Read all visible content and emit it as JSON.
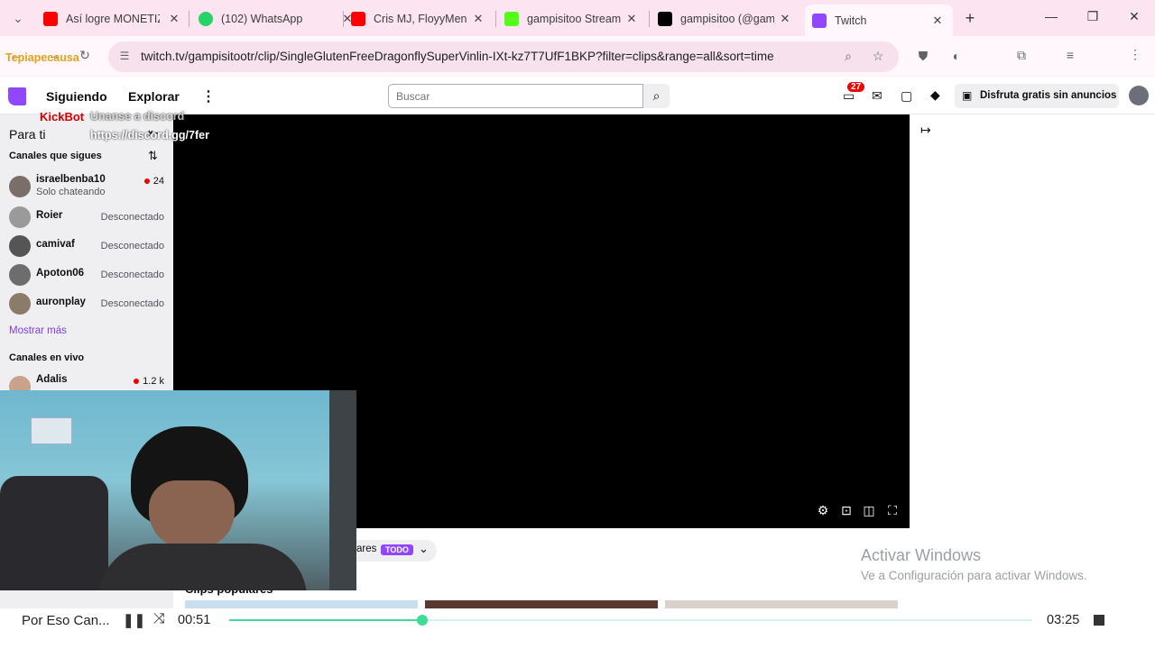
{
  "browser": {
    "tabs": [
      {
        "title": "Así logre MONETIZ",
        "favicon_color": "#ff0000",
        "favicon_icon": "youtube-icon"
      },
      {
        "title": "(102) WhatsApp",
        "favicon_color": "#25d366",
        "favicon_icon": "whatsapp-icon"
      },
      {
        "title": "Cris MJ, FloyyMen",
        "favicon_color": "#ff0000",
        "favicon_icon": "youtube-icon"
      },
      {
        "title": "gampisitoo Stream",
        "favicon_color": "#53fc18",
        "favicon_icon": "kick-icon"
      },
      {
        "title": "gampisitoo (@gam",
        "favicon_color": "#000000",
        "favicon_icon": "x-icon"
      },
      {
        "title": "Twitch",
        "favicon_color": "#9146ff",
        "favicon_icon": "twitch-icon"
      }
    ],
    "url": "twitch.tv/gampisitootr/clip/SingleGlutenFreeDragonflySuperVinlin-IXt-kz7T7UfF1BKP?filter=clips&range=all&sort=time",
    "new_tab": "+"
  },
  "overlay": {
    "brand": "Tepiapecausa",
    "bot_name": "KickBot",
    "bot_msg_1": "Unanse a discord",
    "bot_msg_2": "https://discord.gg/7fer"
  },
  "twitch_nav": {
    "following": "Siguiendo",
    "explore": "Explorar",
    "search_placeholder": "Buscar",
    "notification_count": "27",
    "ad_free": "Disfruta gratis sin anuncios"
  },
  "sidebar": {
    "for_you": "Para ti",
    "followed_header": "Canales que sigues",
    "followed": [
      {
        "name": "israelbenba10",
        "sub": "Solo chateando",
        "viewers": "24",
        "status": ""
      },
      {
        "name": "Roier",
        "sub": "",
        "viewers": "",
        "status": "Desconectado"
      },
      {
        "name": "camivaf",
        "sub": "",
        "viewers": "",
        "status": "Desconectado"
      },
      {
        "name": "Apoton06",
        "sub": "",
        "viewers": "",
        "status": "Desconectado"
      },
      {
        "name": "auronplay",
        "sub": "",
        "viewers": "",
        "status": "Desconectado"
      }
    ],
    "show_more": "Mostrar más",
    "live_header": "Canales en vivo",
    "live": [
      {
        "name": "Adalis",
        "viewers": "1.2 k"
      }
    ]
  },
  "clips": {
    "filter_label": "ares",
    "filter_badge": "TODO",
    "section_title": "Clips populares"
  },
  "watermark": {
    "title": "Activar Windows",
    "subtitle": "Ve a Configuración para activar Windows."
  },
  "media": {
    "title": "Por Eso Can...",
    "elapsed": "00:51",
    "total": "03:25",
    "progress": 0.24
  },
  "colors": {
    "twitch_purple": "#9146ff",
    "tab_strip": "#fce4f0",
    "progress": "#3ddc97"
  }
}
